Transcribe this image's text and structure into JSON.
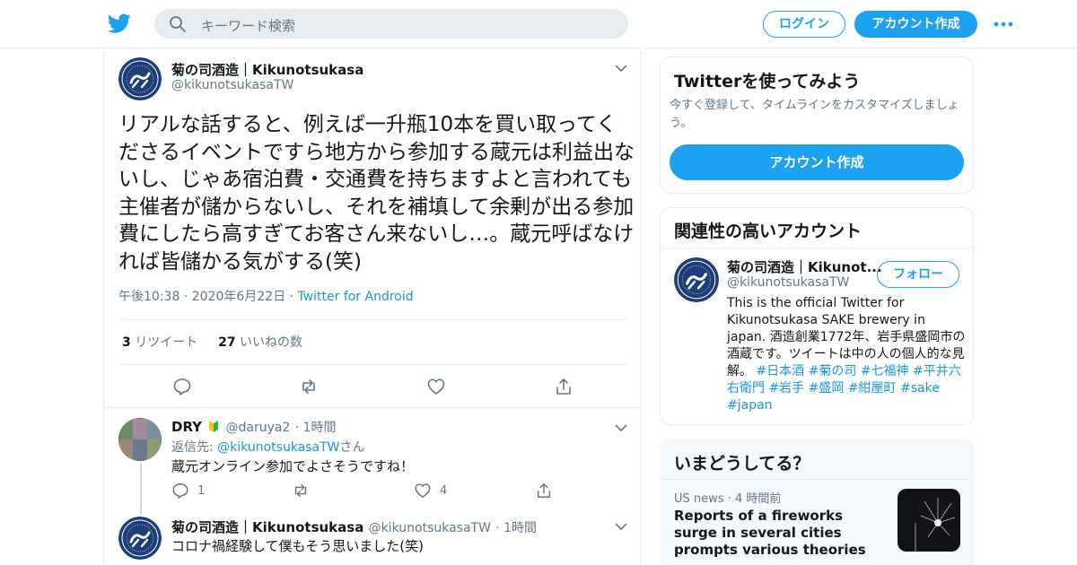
{
  "header": {
    "search_placeholder": "キーワード検索",
    "login_label": "ログイン",
    "signup_label": "アカウント作成"
  },
  "tweet": {
    "author_name": "菊の司酒造｜Kikunotsukasa",
    "author_handle": "@kikunotsukasaTW",
    "text": "リアルな話すると、例えば一升瓶10本を買い取ってくださるイベントですら地方から参加する蔵元は利益出ないし、じゃあ宿泊費・交通費を持ちますよと言われても主催者が儲からないし、それを補填して余剰が出る参加費にしたら高すぎてお客さん来ないし…。蔵元呼ばなければ皆儲かる気がする(笑)",
    "time": "午後10:38",
    "date": "2020年6月22日",
    "source": "Twitter for Android",
    "retweet_count": "3",
    "retweet_label": "リツイート",
    "like_count": "27",
    "like_label": "いいねの数"
  },
  "replies": [
    {
      "author_name": "DRY",
      "author_handle": "@daruya2",
      "time": "1時間",
      "reply_prefix": "返信先: ",
      "reply_target": "@kikunotsukasaTW",
      "reply_suffix": "さん",
      "text": "蔵元オンライン参加でよさそうですね！",
      "reply_count": "1",
      "like_count": "4"
    },
    {
      "author_name": "菊の司酒造｜Kikunotsukasa",
      "author_handle": "@kikunotsukasaTW",
      "time": "1時間",
      "text": "コロナ禍経験して僕もそう思いました(笑)"
    }
  ],
  "sidebar": {
    "try_title": "Twitterを使ってみよう",
    "try_sub": "今すぐ登録して、タイムラインをカスタマイズしましょう。",
    "try_button": "アカウント作成",
    "related_title": "関連性の高いアカウント",
    "related_name": "菊の司酒造｜Kikunot...",
    "related_handle": "@kikunotsukasaTW",
    "follow_label": "フォロー",
    "bio_text": "This is the official Twitter for Kikunotsukasa SAKE brewery in japan. 酒造創業1772年、岩手県盛岡市の酒蔵です。ツイートは中の人の個人的な見解。",
    "bio_tags_1": "#日本酒 #菊の司 #七福神 #平井六右衛門 #岩手 #盛岡 #紺屋町",
    "bio_tags_2": "#sake #japan",
    "trends_title": "いまどうしてる？",
    "trend_meta": "US news · 4 時間前",
    "trend_title": "Reports of a fireworks surge in several cities prompts various theories"
  },
  "colors": {
    "accent": "#1da1f2",
    "link": "#1b95e0",
    "secondary_text": "#657786",
    "border": "#e6ecf0",
    "logo_navy": "#1d3d7a"
  }
}
